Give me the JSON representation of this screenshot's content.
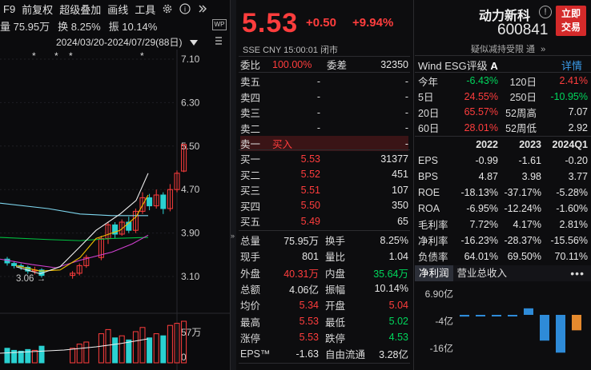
{
  "toolbar": {
    "items": [
      "F9",
      "前复权",
      "超级叠加",
      "画线",
      "工具"
    ],
    "gear_icon": "gear-icon",
    "collapse_icon": "double-chevron-right-icon"
  },
  "stats": {
    "volume": "量 75.95万",
    "turnover": "换 8.25%",
    "amplitude": "振 10.14%"
  },
  "date_range": "2024/03/20-2024/07/29(88日)",
  "chart_data": {
    "type": "candlestick",
    "y_ticks": [
      "7.10",
      "6.30",
      "5.50",
      "4.70",
      "3.90",
      "3.10"
    ],
    "volume_ticks": [
      "57万",
      "0"
    ],
    "low_marker": "3.06",
    "stars": [
      "*",
      "*",
      "*",
      "*",
      "*"
    ],
    "colors": {
      "up": "#ff3d3d",
      "down": "#2ad1d1",
      "ma5": "#f0f0f0",
      "ma10": "#f0c000",
      "ma20": "#d040d0",
      "ma30": "#00c040",
      "ma60": "#7fd8f0"
    }
  },
  "quote": {
    "price": "5.53",
    "change": "+0.50",
    "change_pct": "+9.94%",
    "meta": "SSE  CNY  15:00:01  闭市"
  },
  "orderbook": {
    "ratio_label": "委比",
    "ratio": "100.00%",
    "diff_label": "委差",
    "diff": "32350",
    "asks": [
      {
        "label": "卖五",
        "price": "-",
        "vol": "-"
      },
      {
        "label": "卖四",
        "price": "-",
        "vol": "-"
      },
      {
        "label": "卖三",
        "price": "-",
        "vol": "-"
      },
      {
        "label": "卖二",
        "price": "-",
        "vol": "-"
      },
      {
        "label": "卖一",
        "price": "买入",
        "vol": "-"
      }
    ],
    "bids": [
      {
        "label": "买一",
        "price": "5.53",
        "vol": "31377"
      },
      {
        "label": "买二",
        "price": "5.52",
        "vol": "451"
      },
      {
        "label": "买三",
        "price": "5.51",
        "vol": "107"
      },
      {
        "label": "买四",
        "price": "5.50",
        "vol": "350"
      },
      {
        "label": "买五",
        "price": "5.49",
        "vol": "65"
      }
    ]
  },
  "details": [
    {
      "l1": "总量",
      "v1": "75.95万",
      "c1": "white",
      "l2": "换手",
      "v2": "8.25%",
      "c2": "white"
    },
    {
      "l1": "现手",
      "v1": "801",
      "c1": "white",
      "l2": "量比",
      "v2": "1.04",
      "c2": "white"
    },
    {
      "l1": "外盘",
      "v1": "40.31万",
      "c1": "red",
      "l2": "内盘",
      "v2": "35.64万",
      "c2": "green"
    },
    {
      "l1": "总额",
      "v1": "4.06亿",
      "c1": "white",
      "l2": "振幅",
      "v2": "10.14%",
      "c2": "white"
    },
    {
      "l1": "均价",
      "v1": "5.34",
      "c1": "red",
      "l2": "开盘",
      "v2": "5.04",
      "c2": "red"
    },
    {
      "l1": "最高",
      "v1": "5.53",
      "c1": "red",
      "l2": "最低",
      "v2": "5.02",
      "c2": "green"
    },
    {
      "l1": "涨停",
      "v1": "5.53",
      "c1": "red",
      "l2": "跌停",
      "v2": "4.53",
      "c2": "green"
    },
    {
      "l1": "EPS™",
      "v1": "-1.63",
      "c1": "white",
      "l2": "自由流通",
      "v2": "3.28亿",
      "c2": "white"
    }
  ],
  "stock": {
    "name": "动力新科",
    "code": "600841",
    "trade_button": "立即交易",
    "info_icon": "info-icon",
    "hint": "疑似减持受限  通",
    "more_icon": "double-chevron-right-icon"
  },
  "esg": {
    "prefix": "Wind  ESG评级",
    "grade": "A",
    "detail_link": "详情"
  },
  "returns": [
    {
      "a": "今年",
      "b": "-6.43%",
      "bc": "green",
      "c": "120日",
      "d": "2.41%",
      "dc": "red"
    },
    {
      "a": "5日",
      "b": "24.55%",
      "bc": "red",
      "c": "250日",
      "d": "-10.95%",
      "dc": "green"
    },
    {
      "a": "20日",
      "b": "65.57%",
      "bc": "red",
      "c": "52周高",
      "d": "7.07",
      "dc": "white"
    },
    {
      "a": "60日",
      "b": "28.01%",
      "bc": "red",
      "c": "52周低",
      "d": "2.92",
      "dc": "white"
    }
  ],
  "fin_header": [
    "",
    "2022",
    "2023",
    "2024Q1"
  ],
  "financials": [
    {
      "a": "EPS",
      "b": "-0.99",
      "c": "-1.61",
      "d": "-0.20"
    },
    {
      "a": "BPS",
      "b": "4.87",
      "c": "3.98",
      "d": "3.77"
    },
    {
      "a": "ROE",
      "b": "-18.13%",
      "c": "-37.17%",
      "d": "-5.28%"
    },
    {
      "a": "ROA",
      "b": "-6.95%",
      "c": "-12.24%",
      "d": "-1.60%"
    },
    {
      "a": "毛利率",
      "b": "7.72%",
      "c": "4.17%",
      "d": "2.81%"
    },
    {
      "a": "净利率",
      "b": "-16.23%",
      "c": "-28.37%",
      "d": "-15.56%"
    },
    {
      "a": "负债率",
      "b": "64.01%",
      "c": "69.50%",
      "d": "70.11%"
    }
  ],
  "tabs": [
    "净利润",
    "营业总收入"
  ],
  "more_icon": "ellipsis-icon",
  "profit_chart": {
    "y_ticks": [
      "6.90亿",
      "-4亿",
      "-16亿"
    ],
    "values": [
      -0.5,
      -0.4,
      -0.3,
      -0.2,
      1.9,
      -7.5,
      -11,
      -4.5
    ],
    "colors": [
      "#2e8bd8",
      "#2e8bd8",
      "#2e8bd8",
      "#2e8bd8",
      "#2e8bd8",
      "#2e8bd8",
      "#2e8bd8",
      "#e58a2e"
    ]
  }
}
